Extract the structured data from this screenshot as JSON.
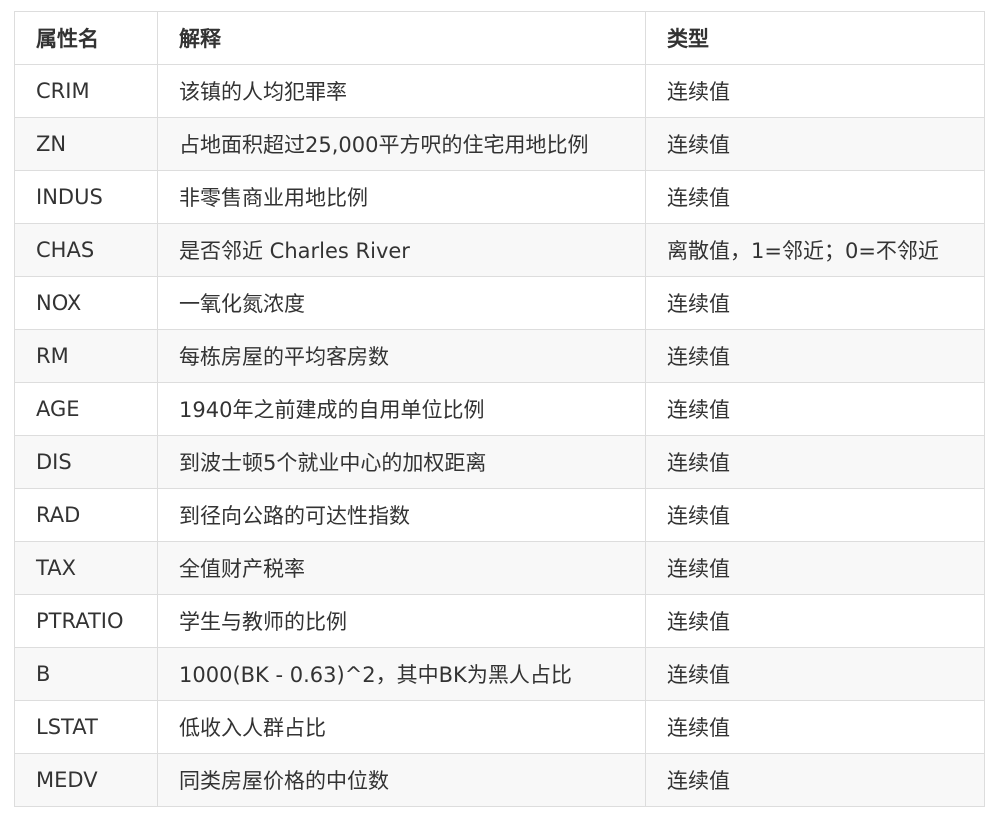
{
  "table": {
    "headers": [
      "属性名",
      "解释",
      "类型"
    ],
    "rows": [
      [
        "CRIM",
        "该镇的人均犯罪率",
        "连续值"
      ],
      [
        "ZN",
        "占地面积超过25,000平方呎的住宅用地比例",
        "连续值"
      ],
      [
        "INDUS",
        "非零售商业用地比例",
        "连续值"
      ],
      [
        "CHAS",
        "是否邻近 Charles River",
        "离散值，1=邻近；0=不邻近"
      ],
      [
        "NOX",
        "一氧化氮浓度",
        "连续值"
      ],
      [
        "RM",
        "每栋房屋的平均客房数",
        "连续值"
      ],
      [
        "AGE",
        "1940年之前建成的自用单位比例",
        "连续值"
      ],
      [
        "DIS",
        "到波士顿5个就业中心的加权距离",
        "连续值"
      ],
      [
        "RAD",
        "到径向公路的可达性指数",
        "连续值"
      ],
      [
        "TAX",
        "全值财产税率",
        "连续值"
      ],
      [
        "PTRATIO",
        "学生与教师的比例",
        "连续值"
      ],
      [
        "B",
        "1000(BK - 0.63)^2，其中BK为黑人占比",
        "连续值"
      ],
      [
        "LSTAT",
        "低收入人群占比",
        "连续值"
      ],
      [
        "MEDV",
        "同类房屋价格的中位数",
        "连续值"
      ]
    ]
  }
}
